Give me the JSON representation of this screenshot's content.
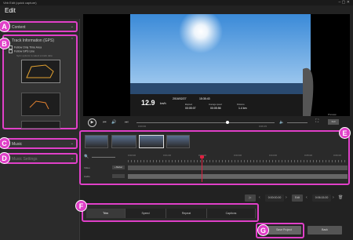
{
  "window": {
    "title": "Virb Edit (quick capture)"
  },
  "page": {
    "heading": "Edit"
  },
  "badges": {
    "a": "A",
    "b": "B",
    "c": "C",
    "d": "D",
    "e": "E",
    "f": "F",
    "g": "G"
  },
  "sidebar": {
    "content_label": "Content",
    "track_label": "Track Information (GPS)",
    "track_options": [
      "Follow Only Time Area",
      "Follow GPS Line"
    ],
    "track_note": "Sync options to select a track data",
    "music_label": "Music",
    "music_settings_label": "Music Settings"
  },
  "video": {
    "speed": "12.9",
    "speed_unit": "km/h",
    "date": "2016/02/27",
    "time": "15:35:43",
    "elapsed": "00:05:07",
    "avg_time": "00:05:56",
    "distance": "1.4 km",
    "elapsed_label": "Elapsed",
    "avg_label": "Average speed",
    "distance_label": "Distance"
  },
  "playback": {
    "time_start": "0:00:00",
    "time_end": "0:06:15",
    "preview_label": "Preview",
    "full_label": "Full"
  },
  "timeline": {
    "ruler": [
      "0:00:00",
      "0:01:00",
      "0:02:00",
      "0:03:00",
      "0:04:00",
      "0:05:00",
      "0:06:00"
    ],
    "video_track": "Video",
    "audio_track": "Audio",
    "add_label": "+ Marker"
  },
  "nav": {
    "first": "|<",
    "prev_time": "0:00:00.00",
    "mid": "Edit",
    "next_time": "0:06:15.00",
    "last": ">|"
  },
  "tabs": [
    "Trim",
    "Speed",
    "Repeat",
    "Captions"
  ],
  "actions": {
    "save": "Save Project",
    "back": "Back"
  },
  "colors": {
    "highlight": "#e040c8",
    "accent_playhead": "#e02040"
  }
}
